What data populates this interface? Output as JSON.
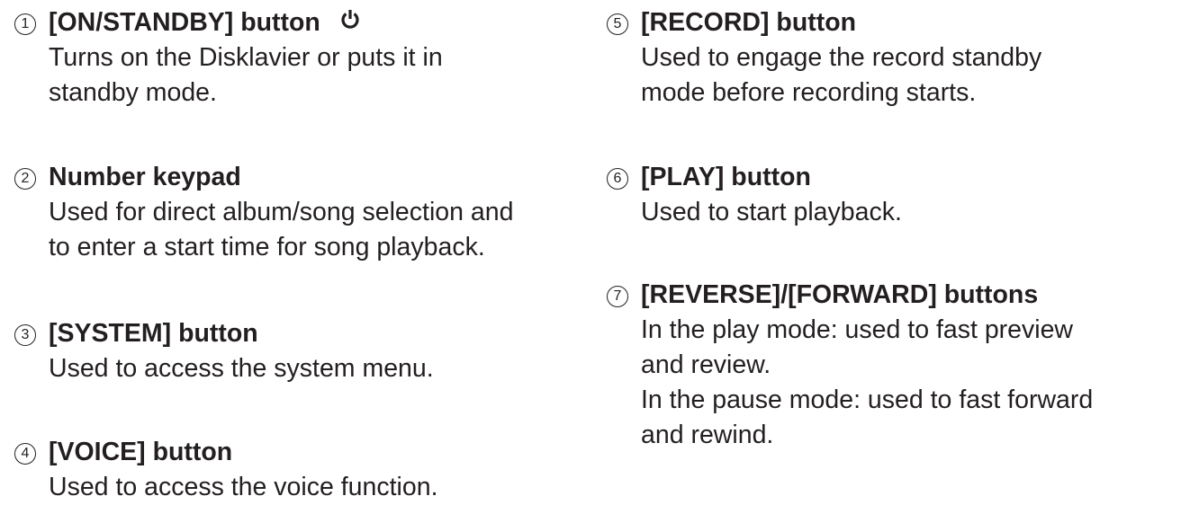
{
  "items": [
    {
      "number": "1",
      "title": "[ON/STANDBY] button",
      "icon": "power-icon",
      "lines": [
        "Turns on the Disklavier or puts it in",
        "standby mode."
      ]
    },
    {
      "number": "2",
      "title": "Number keypad",
      "lines": [
        "Used for direct album/song selection and",
        "to enter a start time for song playback."
      ]
    },
    {
      "number": "3",
      "title": "[SYSTEM] button",
      "lines": [
        "Used to access the system menu."
      ]
    },
    {
      "number": "4",
      "title": "[VOICE] button",
      "lines": [
        "Used to access the voice function."
      ]
    },
    {
      "number": "5",
      "title": "[RECORD] button",
      "lines": [
        "Used to engage the record standby",
        "mode before recording starts."
      ]
    },
    {
      "number": "6",
      "title": "[PLAY] button",
      "lines": [
        "Used to start playback."
      ]
    },
    {
      "number": "7",
      "title": "[REVERSE]/[FORWARD] buttons",
      "lines": [
        "In the play mode: used to fast preview",
        "and review.",
        "In the pause mode: used to fast forward",
        "and rewind."
      ]
    }
  ]
}
